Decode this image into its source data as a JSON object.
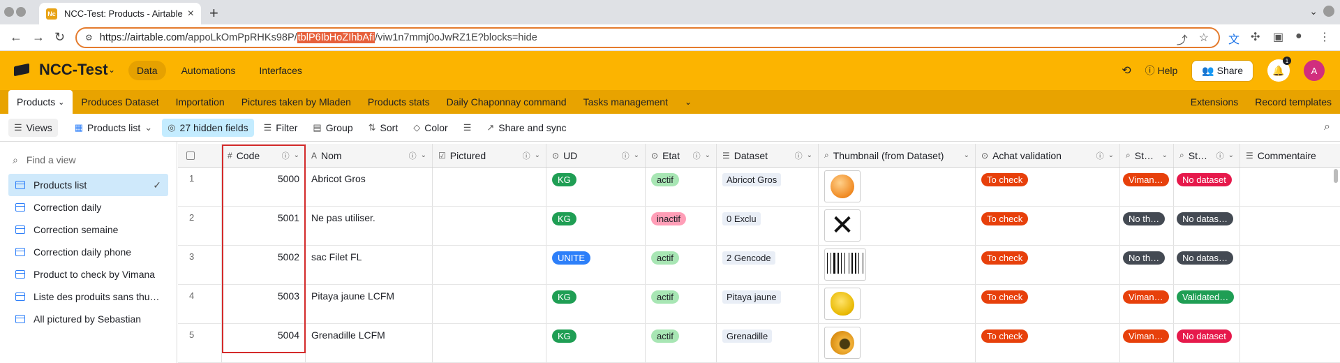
{
  "browser": {
    "tab_title": "NCC-Test: Products - Airtable",
    "favicon_text": "Nc",
    "url_scheme_host": "https://airtable.com/",
    "url_part1": "appoLkOmPpRHKs98P/",
    "url_highlight": "tblP6IbHoZIhbAfi",
    "url_part2": "/viw1n7mmj0oJwRZ1E?blocks=hide"
  },
  "app": {
    "base_name": "NCC-Test",
    "nav": [
      "Data",
      "Automations",
      "Interfaces"
    ],
    "help": "Help",
    "share": "Share",
    "notif_count": "1",
    "avatar": "A"
  },
  "table_tabs": [
    "Products",
    "Produces Dataset",
    "Importation",
    "Pictures taken by Mladen",
    "Products stats",
    "Daily Chaponnay command",
    "Tasks management"
  ],
  "right_tabs": [
    "Extensions",
    "Record templates"
  ],
  "viewbar": {
    "views": "Views",
    "current_view": "Products list",
    "hidden_fields": "27 hidden fields",
    "filter": "Filter",
    "group": "Group",
    "sort": "Sort",
    "color": "Color",
    "share_sync": "Share and sync"
  },
  "sidebar": {
    "find_placeholder": "Find a view",
    "items": [
      "Products list",
      "Correction daily",
      "Correction semaine",
      "Correction daily phone",
      "Product to check by Vimana",
      "Liste des produits sans thum…",
      "All pictured by Sebastian"
    ]
  },
  "columns": [
    "Code",
    "Nom",
    "Pictured",
    "UD",
    "Etat",
    "Dataset",
    "Thumbnail (from Dataset)",
    "Achat validation",
    "St…",
    "Sta…",
    "Commentaire"
  ],
  "colors": {
    "header_bg": "#fcb400",
    "tabs_bg": "#e8a300",
    "red_tag": "#d9400b",
    "dark_tag": "#444a53",
    "pink_tag": "#e6194b",
    "green_tag": "#1f9e54",
    "highlight_box": "#d32a2a"
  },
  "rows": [
    {
      "num": "1",
      "code": "5000",
      "nom": "Abricot Gros",
      "ud": "KG",
      "etat": "actif",
      "dataset": "Abricot Gros",
      "thumb": "apricot",
      "achat": "To check",
      "st": "Viman…",
      "sta": "No dataset"
    },
    {
      "num": "2",
      "code": "5001",
      "nom": "Ne pas utiliser.",
      "ud": "KG",
      "etat": "inactif",
      "dataset": "0 Exclu",
      "thumb": "cross",
      "achat": "To check",
      "st": "No th…",
      "sta": "No datas…"
    },
    {
      "num": "3",
      "code": "5002",
      "nom": "sac Filet FL",
      "ud": "UNITE",
      "etat": "actif",
      "dataset": "2 Gencode",
      "thumb": "barcode",
      "achat": "To check",
      "st": "No th…",
      "sta": "No datas…"
    },
    {
      "num": "4",
      "code": "5003",
      "nom": "Pitaya jaune LCFM",
      "ud": "KG",
      "etat": "actif",
      "dataset": "Pitaya jaune",
      "thumb": "pitaya",
      "achat": "To check",
      "st": "Viman…",
      "sta": "Validated…"
    },
    {
      "num": "5",
      "code": "5004",
      "nom": "Grenadille LCFM",
      "ud": "KG",
      "etat": "actif",
      "dataset": "Grenadille",
      "thumb": "grenadille",
      "achat": "To check",
      "st": "Viman…",
      "sta": "No dataset"
    }
  ]
}
